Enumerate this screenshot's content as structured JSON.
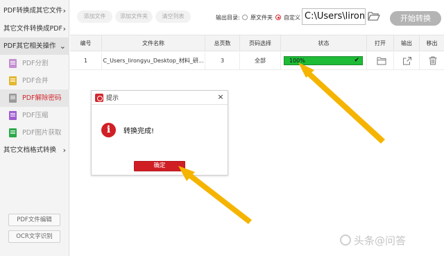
{
  "sidebar": {
    "categories": [
      {
        "label": "PDF转换成其它文件"
      },
      {
        "label": "其它文件转换成PDF"
      },
      {
        "label": "PDF其它相关操作"
      },
      {
        "label": "其它文档格式转换"
      }
    ],
    "items": [
      {
        "label": "PDF分割",
        "color": "#c48fd0"
      },
      {
        "label": "PDF合并",
        "color": "#e3b72f"
      },
      {
        "label": "PDF解除密码",
        "color": "#9a9a9a"
      },
      {
        "label": "PDF压缩",
        "color": "#9f5fd0"
      },
      {
        "label": "PDF图片获取",
        "color": "#2aa84a"
      }
    ],
    "bottom_buttons": [
      {
        "label": "PDF文件编辑"
      },
      {
        "label": "OCR文字识别"
      }
    ]
  },
  "toolbar": {
    "add_file": "添加文件",
    "add_folder": "添加文件夹",
    "clear_list": "清空列表",
    "output_dir_label": "输出目录:",
    "radio_original": "原文件夹",
    "radio_custom": "自定义",
    "path_value": "C:\\Users\\lirongyu",
    "start_button": "开始转换"
  },
  "table": {
    "headers": [
      "编号",
      "文件名称",
      "总页数",
      "页码选择",
      "状态",
      "打开",
      "输出",
      "移出"
    ],
    "rows": [
      {
        "index": "1",
        "filename": "C_Users_lirongyu_Desktop_材料_研...",
        "pages": "3",
        "page_select": "全部",
        "status": "100%",
        "progress": 1.0
      }
    ]
  },
  "dialog": {
    "title": "提示",
    "close": "×",
    "message": "转换完成!",
    "ok": "确定"
  },
  "watermark": "头条@问答",
  "colors": {
    "accent_red": "#d2282d",
    "progress_green": "#1dbb36",
    "arrow_yellow": "#f5b400"
  }
}
